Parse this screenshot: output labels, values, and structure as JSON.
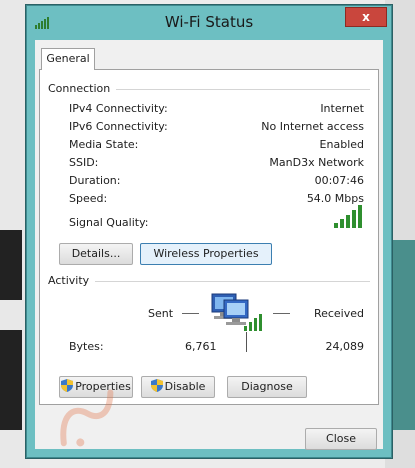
{
  "window": {
    "title": "Wi-Fi Status",
    "close_glyph": "x",
    "title_icon": "wifi-signal-icon"
  },
  "tabs": [
    {
      "label": "General",
      "selected": true
    }
  ],
  "connection": {
    "group_label": "Connection",
    "rows": [
      {
        "label": "IPv4 Connectivity:",
        "value": "Internet"
      },
      {
        "label": "IPv6 Connectivity:",
        "value": "No Internet access"
      },
      {
        "label": "Media State:",
        "value": "Enabled"
      },
      {
        "label": "SSID:",
        "value": "ManD3x Network"
      },
      {
        "label": "Duration:",
        "value": "00:07:46"
      },
      {
        "label": "Speed:",
        "value": "54.0 Mbps"
      }
    ],
    "signal_label": "Signal Quality:",
    "signal_bars_filled": 5,
    "signal_bars_total": 5,
    "details_button": "Details...",
    "wireless_button": "Wireless Properties"
  },
  "activity": {
    "group_label": "Activity",
    "sent_label": "Sent",
    "received_label": "Received",
    "bytes_label": "Bytes:",
    "bytes_sent": "6,761",
    "bytes_received": "24,089"
  },
  "buttons": {
    "properties": "Properties",
    "disable": "Disable",
    "diagnose": "Diagnose",
    "close": "Close"
  },
  "colors": {
    "window_frame": "#6dbfc2",
    "close_button": "#c9463d",
    "signal_green": "#2f8f2f",
    "focus_border": "#3c7fb1"
  }
}
